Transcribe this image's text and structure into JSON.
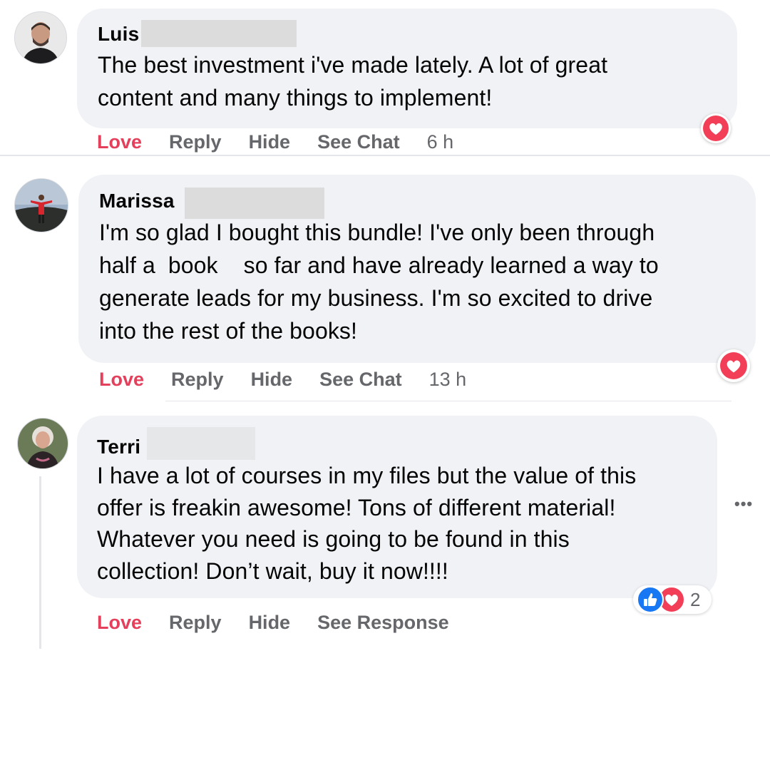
{
  "comments": [
    {
      "author": "Luis",
      "lines": [
        "The best investment i've made lately. A lot of great",
        "content and many things to implement!"
      ],
      "actions": {
        "love": "Love",
        "reply": "Reply",
        "hide": "Hide",
        "chat": "See Chat",
        "time": "6 h"
      },
      "reaction_icon": "heart-icon"
    },
    {
      "author": "Marissa",
      "lines": [
        "I'm so glad I bought this bundle! I've only been through",
        "half a  book    so far and have already learned a way to",
        "generate leads for my business. I'm so excited to drive",
        "into the rest of the books!"
      ],
      "actions": {
        "love": "Love",
        "reply": "Reply",
        "hide": "Hide",
        "chat": "See Chat",
        "time": "13 h"
      },
      "reaction_icon": "heart-icon"
    },
    {
      "author": "Terri",
      "lines": [
        "I have a lot of courses in my files but the value of this",
        "offer is freakin awesome! Tons of different material!",
        "Whatever you need is going to be found in this",
        "collection! Don’t wait, buy it now!!!!"
      ],
      "actions": {
        "love": "Love",
        "reply": "Reply",
        "hide": "Hide",
        "response": "See Response"
      },
      "reaction_icons": [
        "like-icon",
        "heart-icon"
      ],
      "reaction_count": "2",
      "more_label": "•••"
    }
  ],
  "colors": {
    "bubble": "#f0f2f5",
    "love": "#e4405c",
    "action": "#65676b",
    "like_blue": "#1877f2",
    "heart_red": "#f33e58"
  }
}
